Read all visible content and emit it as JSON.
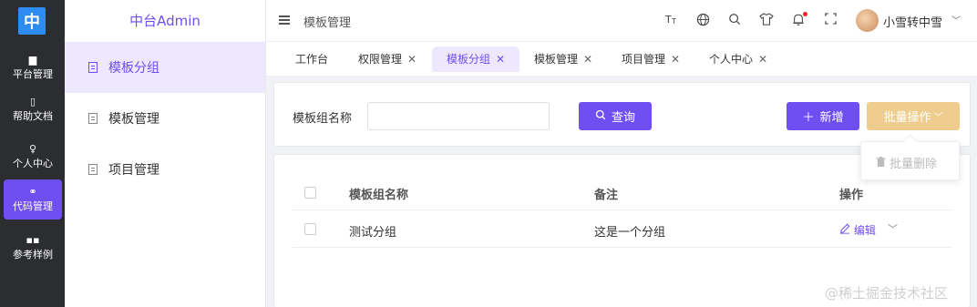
{
  "logo": {
    "text": "中"
  },
  "rail": [
    {
      "label": "平台管理",
      "icon": "monitor-icon",
      "glyph": "▆"
    },
    {
      "label": "帮助文档",
      "icon": "doc-icon",
      "glyph": "▯"
    },
    {
      "label": "个人中心",
      "icon": "user-icon",
      "glyph": "♀"
    },
    {
      "label": "代码管理",
      "icon": "bike-icon",
      "glyph": "⚭"
    },
    {
      "label": "参考样例",
      "icon": "grid-icon",
      "glyph": "▪▪"
    }
  ],
  "sidebar": {
    "title": "中台Admin",
    "items": [
      {
        "label": "模板分组"
      },
      {
        "label": "模板管理"
      },
      {
        "label": "项目管理"
      }
    ]
  },
  "header": {
    "breadcrumb": "模板管理",
    "icons": [
      "font-size-icon",
      "globe-icon",
      "search-icon",
      "shirt-icon",
      "bell-icon",
      "fullscreen-icon"
    ],
    "username": "小雪转中雪"
  },
  "tabs": [
    {
      "label": "工作台"
    },
    {
      "label": "权限管理"
    },
    {
      "label": "模板分组"
    },
    {
      "label": "模板管理"
    },
    {
      "label": "项目管理"
    },
    {
      "label": "个人中心"
    }
  ],
  "search": {
    "label": "模板组名称",
    "value": "",
    "query_label": "查询",
    "add_label": "新增",
    "batch_label": "批量操作"
  },
  "dropdown": {
    "item": "批量删除"
  },
  "table": {
    "columns": [
      "模板组名称",
      "备注",
      "操作"
    ],
    "rows": [
      {
        "name": "测试分组",
        "remark": "这是一个分组",
        "action": "编辑"
      }
    ]
  },
  "colors": {
    "accent": "#6f4ef2",
    "warning": "#efcd8e",
    "rail": "#2b2d31"
  },
  "watermark": "@稀土掘金技术社区"
}
